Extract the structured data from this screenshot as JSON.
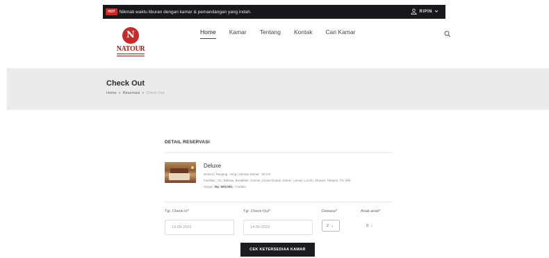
{
  "topbar": {
    "hot_label": "HOT",
    "promo_text": "Nikmati waktu liburan dengan kamar & pemandangan yang indah.",
    "user_name": "RIPIN"
  },
  "brand": {
    "logo_text": "NATOUR",
    "logo_color": "#c42b2b"
  },
  "nav": {
    "items": [
      {
        "label": "Home",
        "active": true
      },
      {
        "label": "Kamar"
      },
      {
        "label": "Tentang"
      },
      {
        "label": "Kontak"
      },
      {
        "label": "Cari Kamar"
      }
    ]
  },
  "page": {
    "title": "Check Out",
    "breadcrumb": [
      "Home",
      "»",
      "Reservasi",
      "»",
      "Check Out"
    ]
  },
  "reservation": {
    "section_title": "DETAIL RESERVASI",
    "room_name": "Deluxe",
    "room_line1": "Deluxe | Ranjang : King | Ukuran Kamar : 30 m2",
    "room_line2": "Fasilitas : AC, Bathup, Breakfast, Cermin, Closet Duduk, Dinner, Lemari, Lunch, Shower, Telepon, TV, Wifi,",
    "price_label": "Harga :",
    "price_value": "Rp. 500,000,-",
    "price_unit": "/ malam"
  },
  "form": {
    "checkin_label": "Tgl. Check-In*",
    "checkin_value": "13-05-2023",
    "checkout_label": "Tgl. Check-Out*",
    "checkout_value": "14-05-2023",
    "dewasa_label": "Dewasa*",
    "dewasa_value": "2",
    "anak_label": "Anak-anak*",
    "anak_value": "0",
    "submit_label": "CEK KETERSEDIAA KAMAR"
  }
}
